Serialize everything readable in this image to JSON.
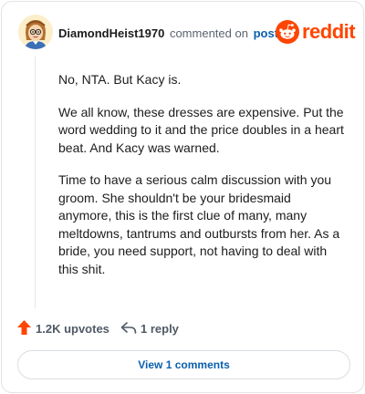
{
  "header": {
    "username": "DiamondHeist1970",
    "action_text": "commented on",
    "post_link": "post",
    "brand_word": "reddit",
    "avatar_icon": "cartoon-avatar-icon",
    "brand_icon": "reddit-alien-icon"
  },
  "comment": {
    "paragraphs": [
      "No, NTA. But Kacy is.",
      "We all know, these dresses are expensive. Put the word wedding to it and the price doubles in a heart beat. And Kacy was warned.",
      "Time to have a serious calm discussion with you groom. She shouldn't be your bridesmaid anymore, this is the first clue of many, many meltdowns, tantrums and outbursts from her. As a bride, you need support, not having to deal with this shit."
    ]
  },
  "actions": {
    "upvotes": "1.2K upvotes",
    "replies": "1 reply",
    "upvote_icon": "upvote-arrow-icon",
    "reply_icon": "reply-arrow-icon"
  },
  "footer": {
    "view_comments": "View 1 comments"
  },
  "colors": {
    "brand": "#ff4500",
    "link": "#0b5fae",
    "text": "#1c1c1c",
    "muted": "#505a66"
  }
}
